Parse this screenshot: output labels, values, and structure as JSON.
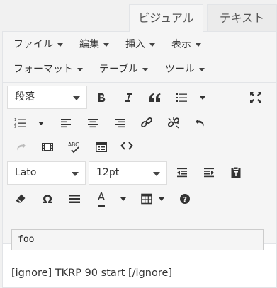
{
  "tabs": {
    "visual": "ビジュアル",
    "text": "テキスト"
  },
  "menubar": {
    "items": [
      {
        "label": "ファイル"
      },
      {
        "label": "編集"
      },
      {
        "label": "挿入"
      },
      {
        "label": "表示"
      },
      {
        "label": "フォーマット"
      },
      {
        "label": "テーブル"
      },
      {
        "label": "ツール"
      }
    ]
  },
  "toolbar": {
    "format_select": "段落",
    "font_family": "Lato",
    "font_size": "12pt",
    "text_color_letter": "A",
    "omega": "Ω",
    "spellcheck_text": "ABC"
  },
  "content": {
    "code_text": "foo",
    "paragraph": "[ignore] TKRP 90 start [/ignore]"
  }
}
